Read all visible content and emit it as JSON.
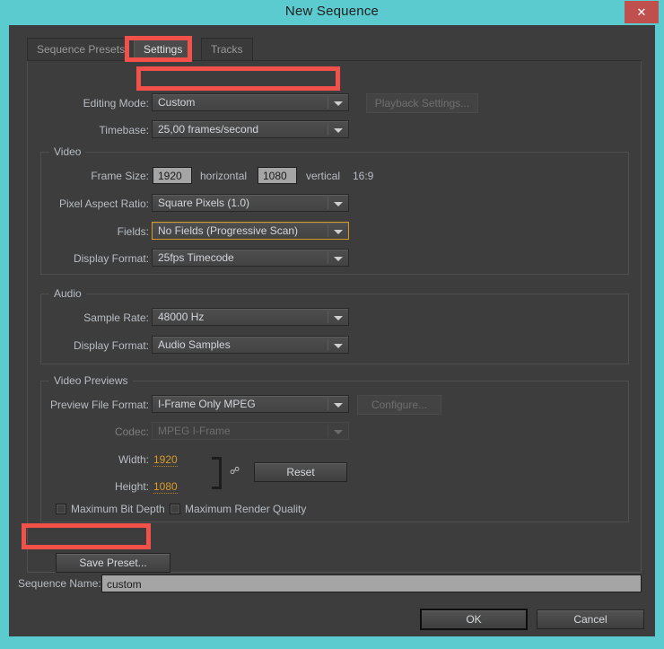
{
  "window": {
    "title": "New Sequence",
    "close_label": "✕",
    "accent_teal": "#5ccbd0",
    "close_red": "#c0504d",
    "annotation_red": "#f2514a",
    "panel_bg": "#3d3d3d"
  },
  "tabs": [
    {
      "label": "Sequence Presets",
      "active": false
    },
    {
      "label": "Settings",
      "active": true
    },
    {
      "label": "Tracks",
      "active": false
    }
  ],
  "top_rows": {
    "editing_mode_label": "Editing Mode:",
    "editing_mode_value": "Custom",
    "playback_settings_label": "Playback Settings...",
    "timebase_label": "Timebase:",
    "timebase_value": "25,00 frames/second"
  },
  "video": {
    "group_title": "Video",
    "frame_size_label": "Frame Size:",
    "frame_width": "1920",
    "horizontal_label": "horizontal",
    "frame_height": "1080",
    "vertical_label": "vertical",
    "aspect_ratio_text": "16:9",
    "pixel_aspect_label": "Pixel Aspect Ratio:",
    "pixel_aspect_value": "Square Pixels (1.0)",
    "fields_label": "Fields:",
    "fields_value": "No Fields (Progressive Scan)",
    "display_format_label": "Display Format:",
    "display_format_value": "25fps Timecode"
  },
  "audio": {
    "group_title": "Audio",
    "sample_rate_label": "Sample Rate:",
    "sample_rate_value": "48000 Hz",
    "display_format_label": "Display Format:",
    "display_format_value": "Audio Samples"
  },
  "video_previews": {
    "group_title": "Video Previews",
    "preview_file_format_label": "Preview File Format:",
    "preview_file_format_value": "I-Frame Only MPEG",
    "configure_label": "Configure...",
    "codec_label": "Codec:",
    "codec_value": "MPEG I-Frame",
    "width_label": "Width:",
    "width_value": "1920",
    "height_label": "Height:",
    "height_value": "1080",
    "reset_label": "Reset",
    "link_icon": "chain-link-icon",
    "max_bit_depth_label": "Maximum Bit Depth",
    "max_bit_depth_checked": false,
    "max_render_quality_label": "Maximum Render Quality",
    "max_render_quality_checked": false
  },
  "save_preset": {
    "label": "Save Preset..."
  },
  "footer": {
    "sequence_name_label": "Sequence Name:",
    "sequence_name_value": "custom",
    "ok_label": "OK",
    "cancel_label": "Cancel"
  }
}
